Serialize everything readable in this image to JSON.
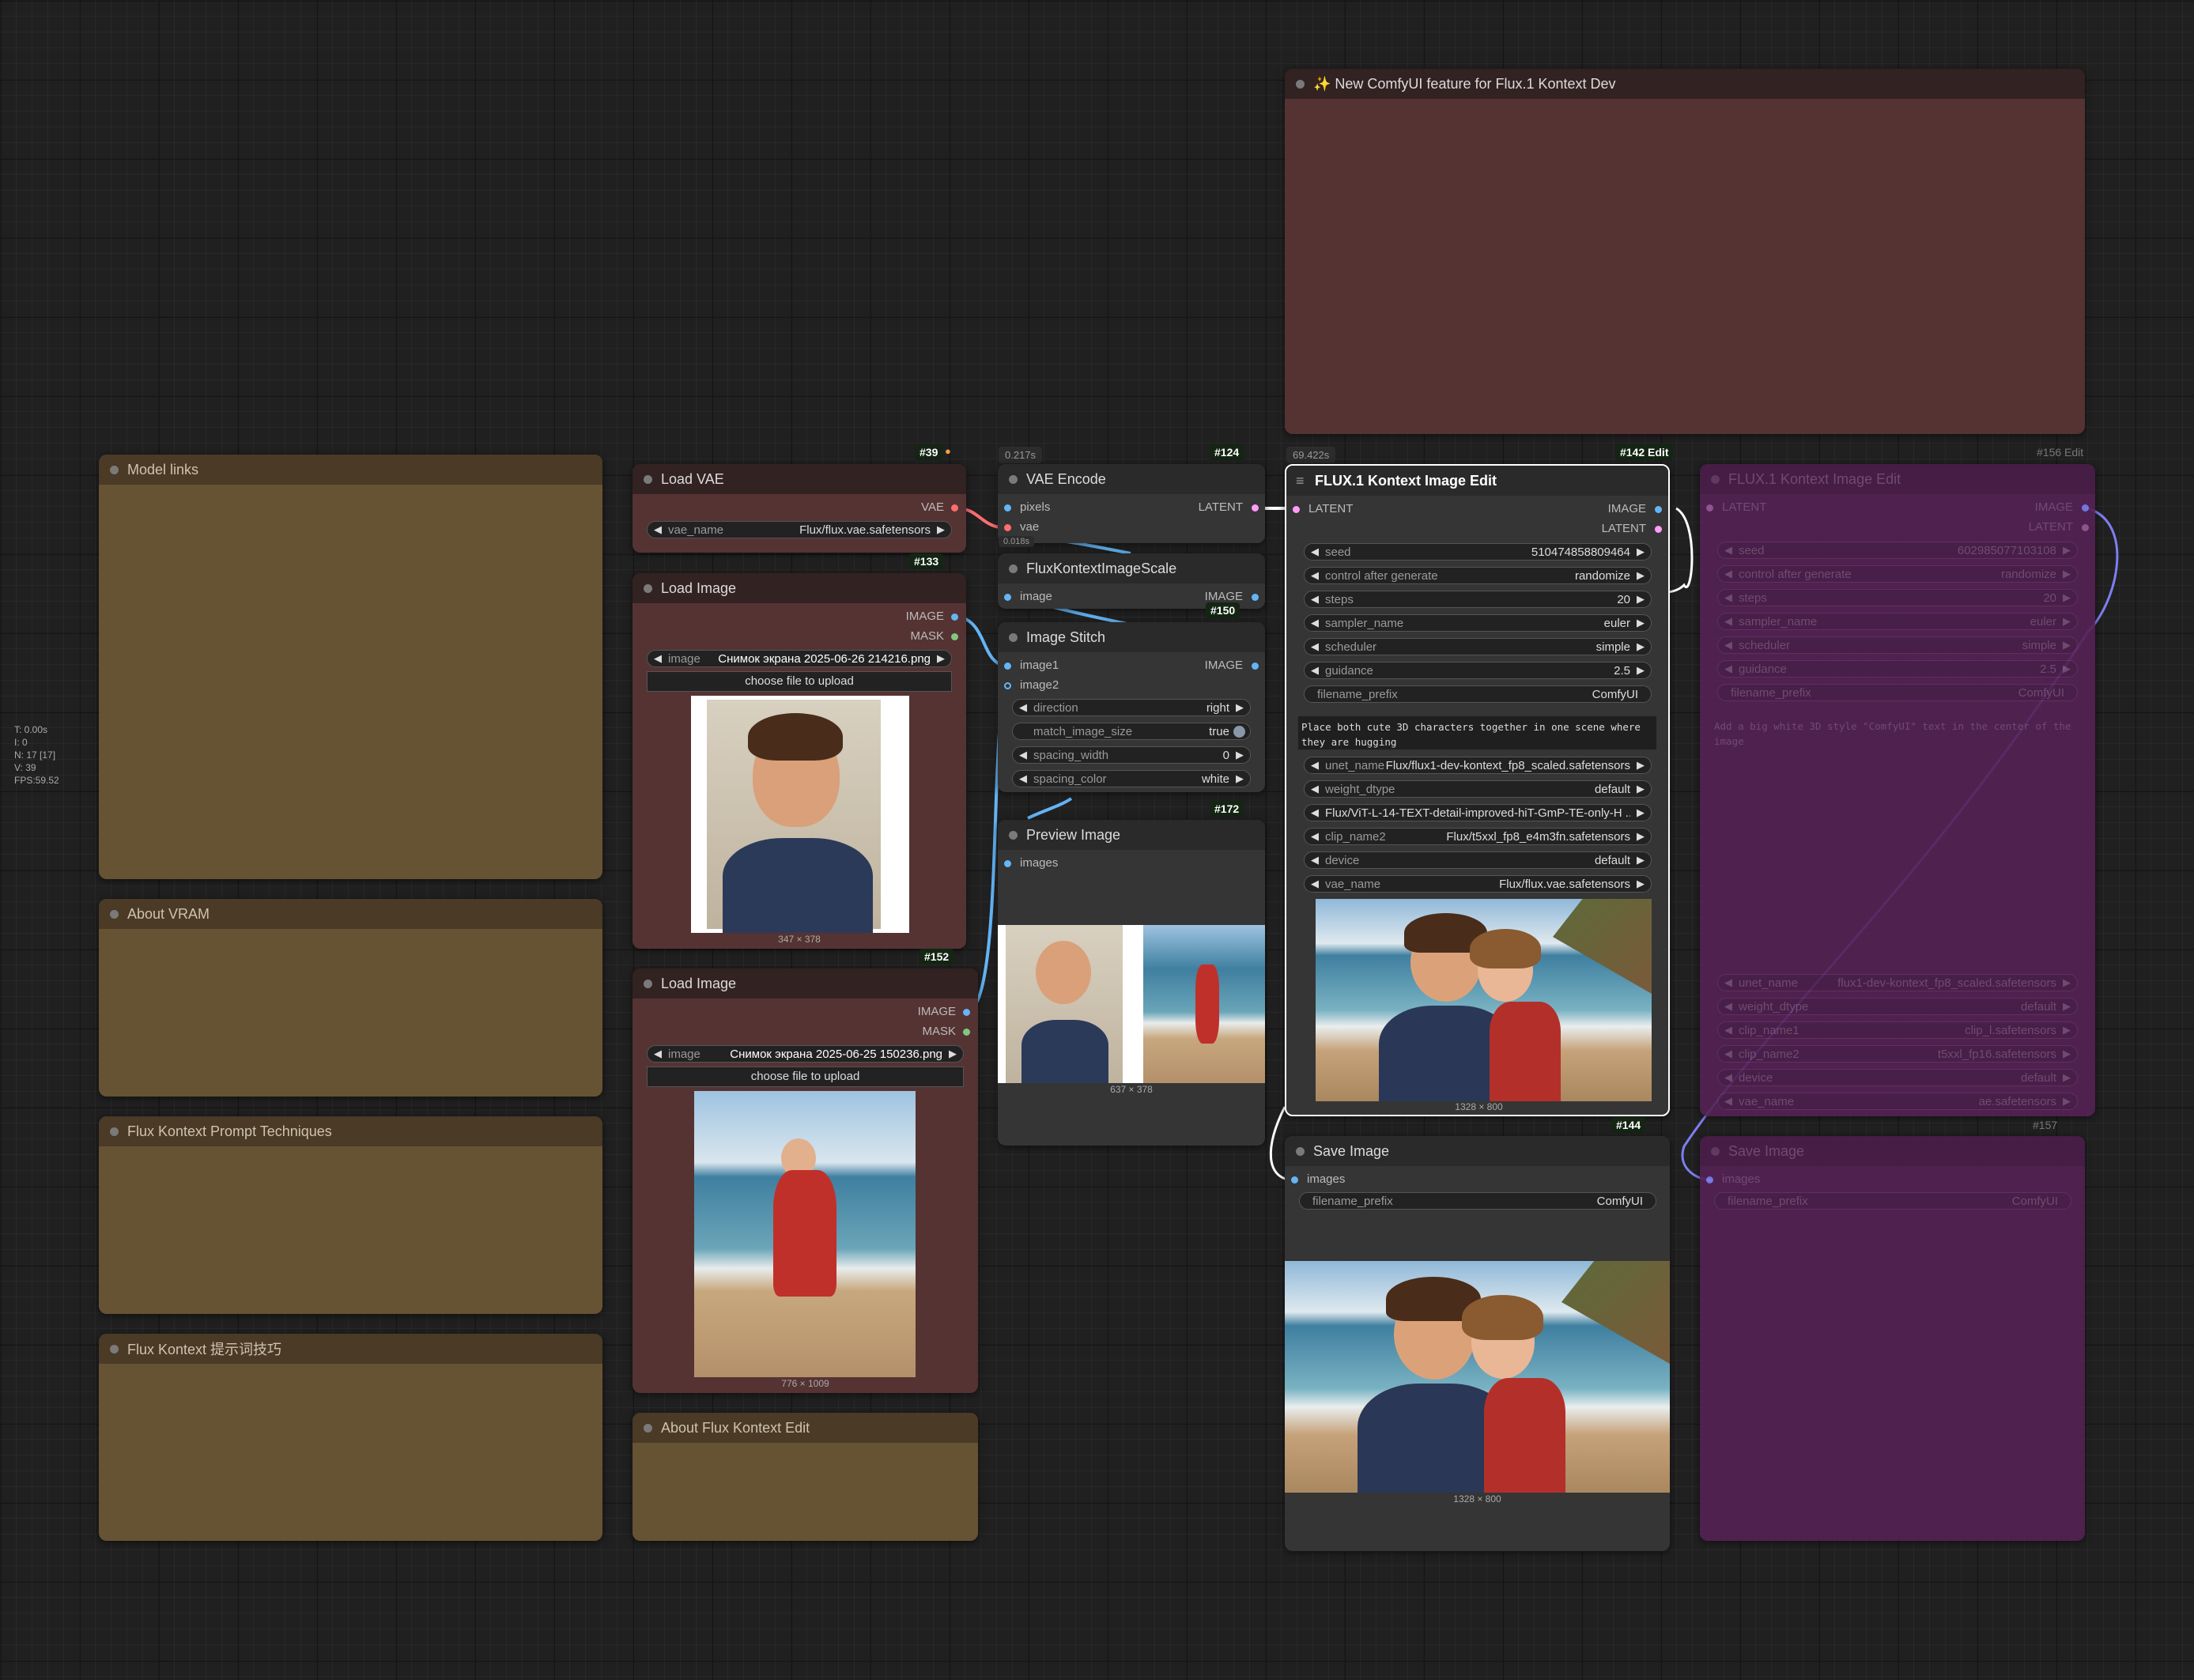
{
  "stats": [
    "T: 0.00s",
    "I: 0",
    "N: 17 [17]",
    "V: 39",
    "FPS:59.52"
  ],
  "notes": {
    "model_links": "Model links",
    "about_vram": "About VRAM",
    "prompt_techniques": "Flux Kontext Prompt Techniques",
    "prompt_techniques_cn": "Flux Kontext 提示词技巧",
    "about_edit": "About Flux Kontext Edit",
    "feature": "✨ New ComfyUI feature for Flux.1 Kontext Dev"
  },
  "load_vae": {
    "badge": "#39",
    "title": "Load VAE",
    "out": "VAE",
    "widget": {
      "label": "vae_name",
      "value": "Flux/flux.vae.safetensors"
    }
  },
  "load_image_1": {
    "badge": "#133",
    "title": "Load Image",
    "out_image": "IMAGE",
    "out_mask": "MASK",
    "widget": {
      "label": "image",
      "value": "Снимок экрана 2025-06-26 214216.png"
    },
    "upload": "choose file to upload",
    "dims": "347 × 378"
  },
  "load_image_2": {
    "badge": "#152",
    "title": "Load Image",
    "out_image": "IMAGE",
    "out_mask": "MASK",
    "widget": {
      "label": "image",
      "value": "Снимок экрана 2025-06-25 150236.png"
    },
    "upload": "choose file to upload",
    "dims": "776 × 1009"
  },
  "vae_encode": {
    "timer": "0.217s",
    "badge": "#124",
    "title": "VAE Encode",
    "in_pixels": "pixels",
    "in_vae": "vae",
    "out": "LATENT"
  },
  "scale": {
    "timer": "0.018s",
    "badge_hidden": "#142",
    "title": "FluxKontextImageScale",
    "in": "image",
    "out": "IMAGE"
  },
  "stitch": {
    "badge": "#150",
    "title": "Image Stitch",
    "in1": "image1",
    "in2": "image2",
    "out": "IMAGE",
    "widgets": [
      {
        "label": "direction",
        "value": "right"
      },
      {
        "label": "match_image_size",
        "value": "true"
      },
      {
        "label": "spacing_width",
        "value": "0"
      },
      {
        "label": "spacing_color",
        "value": "white"
      }
    ]
  },
  "preview": {
    "badge": "#172",
    "title": "Preview Image",
    "in": "images",
    "dims": "637 × 378"
  },
  "flux_edit": {
    "timer": "69.422s",
    "badge": "#142 Edit",
    "title": "FLUX.1 Kontext Image Edit",
    "in_latent": "LATENT",
    "out_image": "IMAGE",
    "out_latent": "LATENT",
    "widgets": [
      {
        "label": "seed",
        "value": "510474858809464"
      },
      {
        "label": "control after generate",
        "value": "randomize"
      },
      {
        "label": "steps",
        "value": "20"
      },
      {
        "label": "sampler_name",
        "value": "euler"
      },
      {
        "label": "scheduler",
        "value": "simple"
      },
      {
        "label": "guidance",
        "value": "2.5"
      }
    ],
    "filename_label": "filename_prefix",
    "filename_value": "ComfyUI",
    "prompt": "Place both cute 3D characters together in one scene where they are hugging",
    "widgets2": [
      {
        "label": "unet_name",
        "value": "Flux/flux1-dev-kontext_fp8_scaled.safetensors"
      },
      {
        "label": "weight_dtype",
        "value": "default"
      },
      {
        "label": "",
        "value": "Flux/ViT-L-14-TEXT-detail-improved-hiT-GmP-TE-only-H ..."
      },
      {
        "label": "clip_name2",
        "value": "Flux/t5xxl_fp8_e4m3fn.safetensors"
      },
      {
        "label": "device",
        "value": "default"
      },
      {
        "label": "vae_name",
        "value": "Flux/flux.vae.safetensors"
      }
    ],
    "dims": "1328 × 800"
  },
  "save": {
    "badge": "#144",
    "title": "Save Image",
    "in": "images",
    "filename_label": "filename_prefix",
    "filename_value": "ComfyUI",
    "dims": "1328 × 800"
  },
  "flux_edit_2": {
    "badge": "#156 Edit",
    "title": "FLUX.1 Kontext Image Edit",
    "in_latent": "LATENT",
    "out_image": "IMAGE",
    "out_latent": "LATENT",
    "widgets": [
      {
        "label": "seed",
        "value": "602985077103108"
      },
      {
        "label": "control after generate",
        "value": "randomize"
      },
      {
        "label": "steps",
        "value": "20"
      },
      {
        "label": "sampler_name",
        "value": "euler"
      },
      {
        "label": "scheduler",
        "value": "simple"
      },
      {
        "label": "guidance",
        "value": "2.5"
      },
      {
        "label": "filename_prefix",
        "value": "ComfyUI"
      }
    ],
    "prompt": "Add a big white 3D style \"ComfyUI\" text in the center of the image",
    "widgets2": [
      {
        "label": "unet_name",
        "value": "flux1-dev-kontext_fp8_scaled.safetensors"
      },
      {
        "label": "weight_dtype",
        "value": "default"
      },
      {
        "label": "clip_name1",
        "value": "clip_l.safetensors"
      },
      {
        "label": "clip_name2",
        "value": "t5xxl_fp16.safetensors"
      },
      {
        "label": "device",
        "value": "default"
      },
      {
        "label": "vae_name",
        "value": "ae.safetensors"
      }
    ]
  },
  "save_2": {
    "badge": "#157",
    "title": "Save Image",
    "in": "images",
    "filename_label": "filename_prefix",
    "filename_value": "ComfyUI"
  },
  "colors": {
    "image_link": "#64b5f6",
    "vae_link": "#ff6e6e",
    "latent_link": "#ff9cf9",
    "mask_link": "#81c784"
  }
}
